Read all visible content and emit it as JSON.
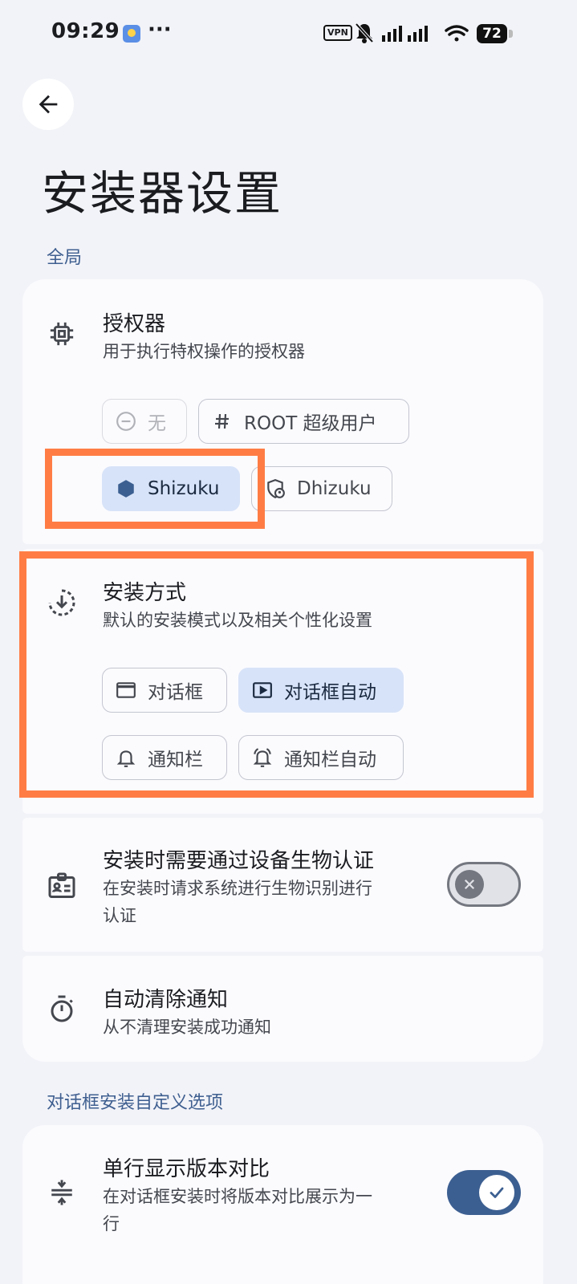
{
  "status_bar": {
    "time": "09:29",
    "dots": "···",
    "vpn": "VPN",
    "battery": "72"
  },
  "page": {
    "title": "安装器设置",
    "back_icon": "arrow-back-icon"
  },
  "sections": {
    "global_label": "全局",
    "dialog_label": "对话框安装自定义选项"
  },
  "authorizer": {
    "icon": "chip-icon",
    "title": "授权器",
    "subtitle": "用于执行特权操作的授权器",
    "options": [
      {
        "label": "无",
        "icon": "minus-circle-icon",
        "state": "disabled"
      },
      {
        "label": "ROOT 超级用户",
        "icon": "hash-icon",
        "state": "normal"
      },
      {
        "label": "Shizuku",
        "icon": "hexagon-icon",
        "state": "selected"
      },
      {
        "label": "Dhizuku",
        "icon": "shield-person-icon",
        "state": "normal"
      }
    ]
  },
  "install_mode": {
    "icon": "download-circle-icon",
    "title": "安装方式",
    "subtitle": "默认的安装模式以及相关个性化设置",
    "options": [
      {
        "label": "对话框",
        "icon": "window-icon",
        "state": "normal"
      },
      {
        "label": "对话框自动",
        "icon": "play-box-icon",
        "state": "selected"
      },
      {
        "label": "通知栏",
        "icon": "bell-icon",
        "state": "normal"
      },
      {
        "label": "通知栏自动",
        "icon": "bell-ring-icon",
        "state": "normal"
      }
    ]
  },
  "biometric": {
    "icon": "badge-icon",
    "title": "安装时需要通过设备生物认证",
    "subtitle_line1": "在安装时请求系统进行生物识别进行",
    "subtitle_line2": "认证",
    "enabled": false
  },
  "auto_clear": {
    "icon": "timer-icon",
    "title": "自动清除通知",
    "subtitle": "从不清理安装成功通知"
  },
  "single_line_compare": {
    "icon": "compress-vertical-icon",
    "title": "单行显示版本对比",
    "subtitle_line1": "在对话框安装时将版本对比展示为一",
    "subtitle_line2": "行",
    "enabled": true
  },
  "colors": {
    "accent": "#3c5f91",
    "selected_chip": "#d7e3f8",
    "highlight": "#ff7d45",
    "background": "#f2f3f8"
  }
}
